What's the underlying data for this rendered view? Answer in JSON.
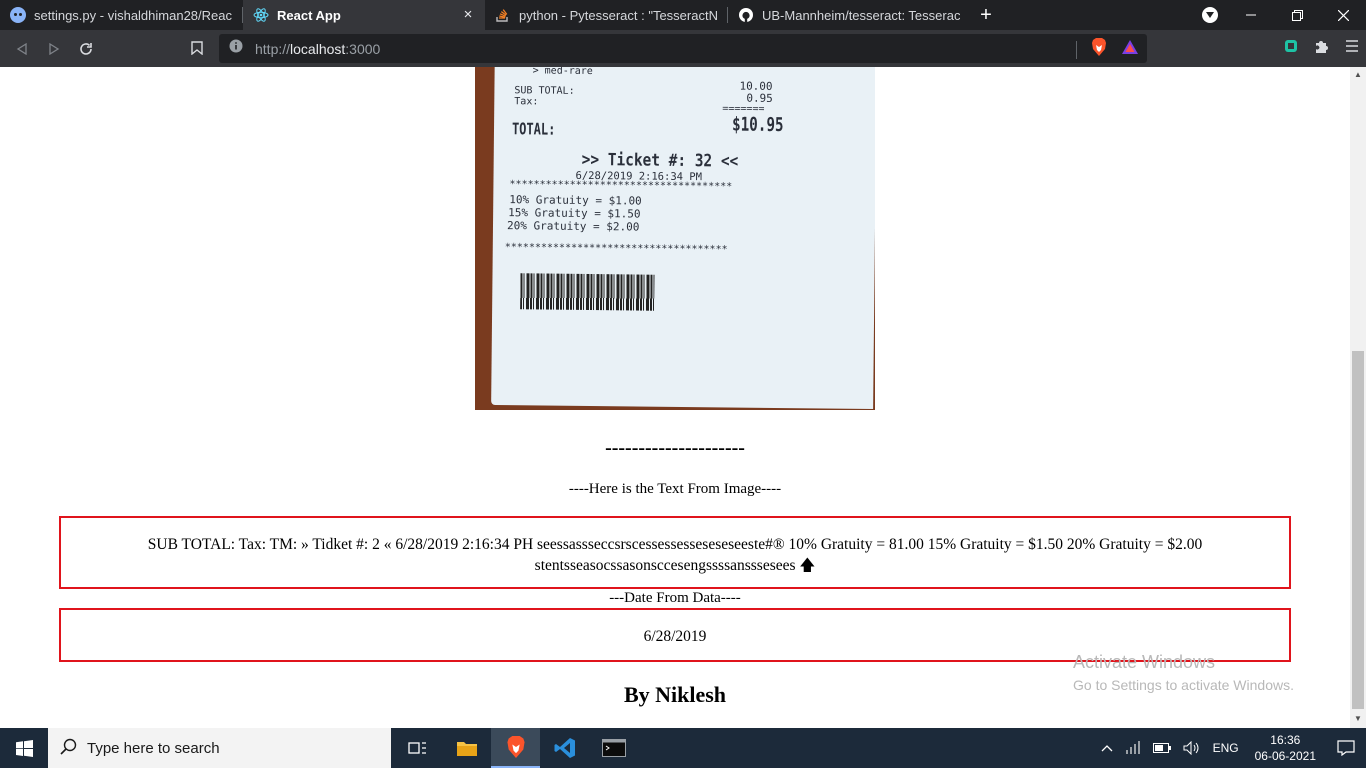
{
  "browser": {
    "tabs": [
      {
        "title": "settings.py - vishaldhiman28/React-an",
        "icon": "github-octocat-icon",
        "active": false
      },
      {
        "title": "React App",
        "icon": "react-icon",
        "active": true
      },
      {
        "title": "python - Pytesseract : \"TesseractNotFo",
        "icon": "stackoverflow-icon",
        "active": false
      },
      {
        "title": "UB-Mannheim/tesseract: Tesseract Op",
        "icon": "github-icon",
        "active": false
      }
    ],
    "url_prefix": "http://",
    "url_host": "localhost",
    "url_port": ":3000"
  },
  "receipt": {
    "line1": " > med-rare",
    "sub_total": "SUB TOTAL:",
    "sub_total_val": "10.00",
    "tax": "Tax:",
    "tax_val": "0.95",
    "eq": "=======",
    "total": "TOTAL:",
    "total_val": "$10.95",
    "ticket": ">> Ticket #: 32 <<",
    "datetime": "6/28/2019 2:16:34 PM",
    "stars": "*************************************",
    "g1": "10% Gratuity = $1.00",
    "g2": "15% Gratuity = $1.50",
    "g3": "20% Gratuity = $2.00"
  },
  "page": {
    "dashes": "---------------------",
    "text_caption": "----Here is the Text From Image----",
    "ocr_text": "SUB TOTAL: Tax: TM: » Tidket #: 2 « 6/28/2019 2:16:34 PH seessassseccsrscessessesseseseseeste#® 10% Gratuity = 81.00 15% Gratuity = $1.50 20% Gratuity = $2.00 stentsseasocssasonsccesengssssansssesees 🡅",
    "date_caption": "---Date From Data----",
    "date_value": "6/28/2019",
    "author": "By Niklesh"
  },
  "watermark": {
    "line1": "Activate Windows",
    "line2": "Go to Settings to activate Windows."
  },
  "taskbar": {
    "search_placeholder": "Type here to search",
    "lang": "ENG",
    "time": "16:36",
    "date": "06-06-2021"
  },
  "colors": {
    "tab_bg": "#202124",
    "toolbar_bg": "#35363a",
    "box_border": "#e0141c",
    "taskbar_bg": "#1c2a3a"
  }
}
